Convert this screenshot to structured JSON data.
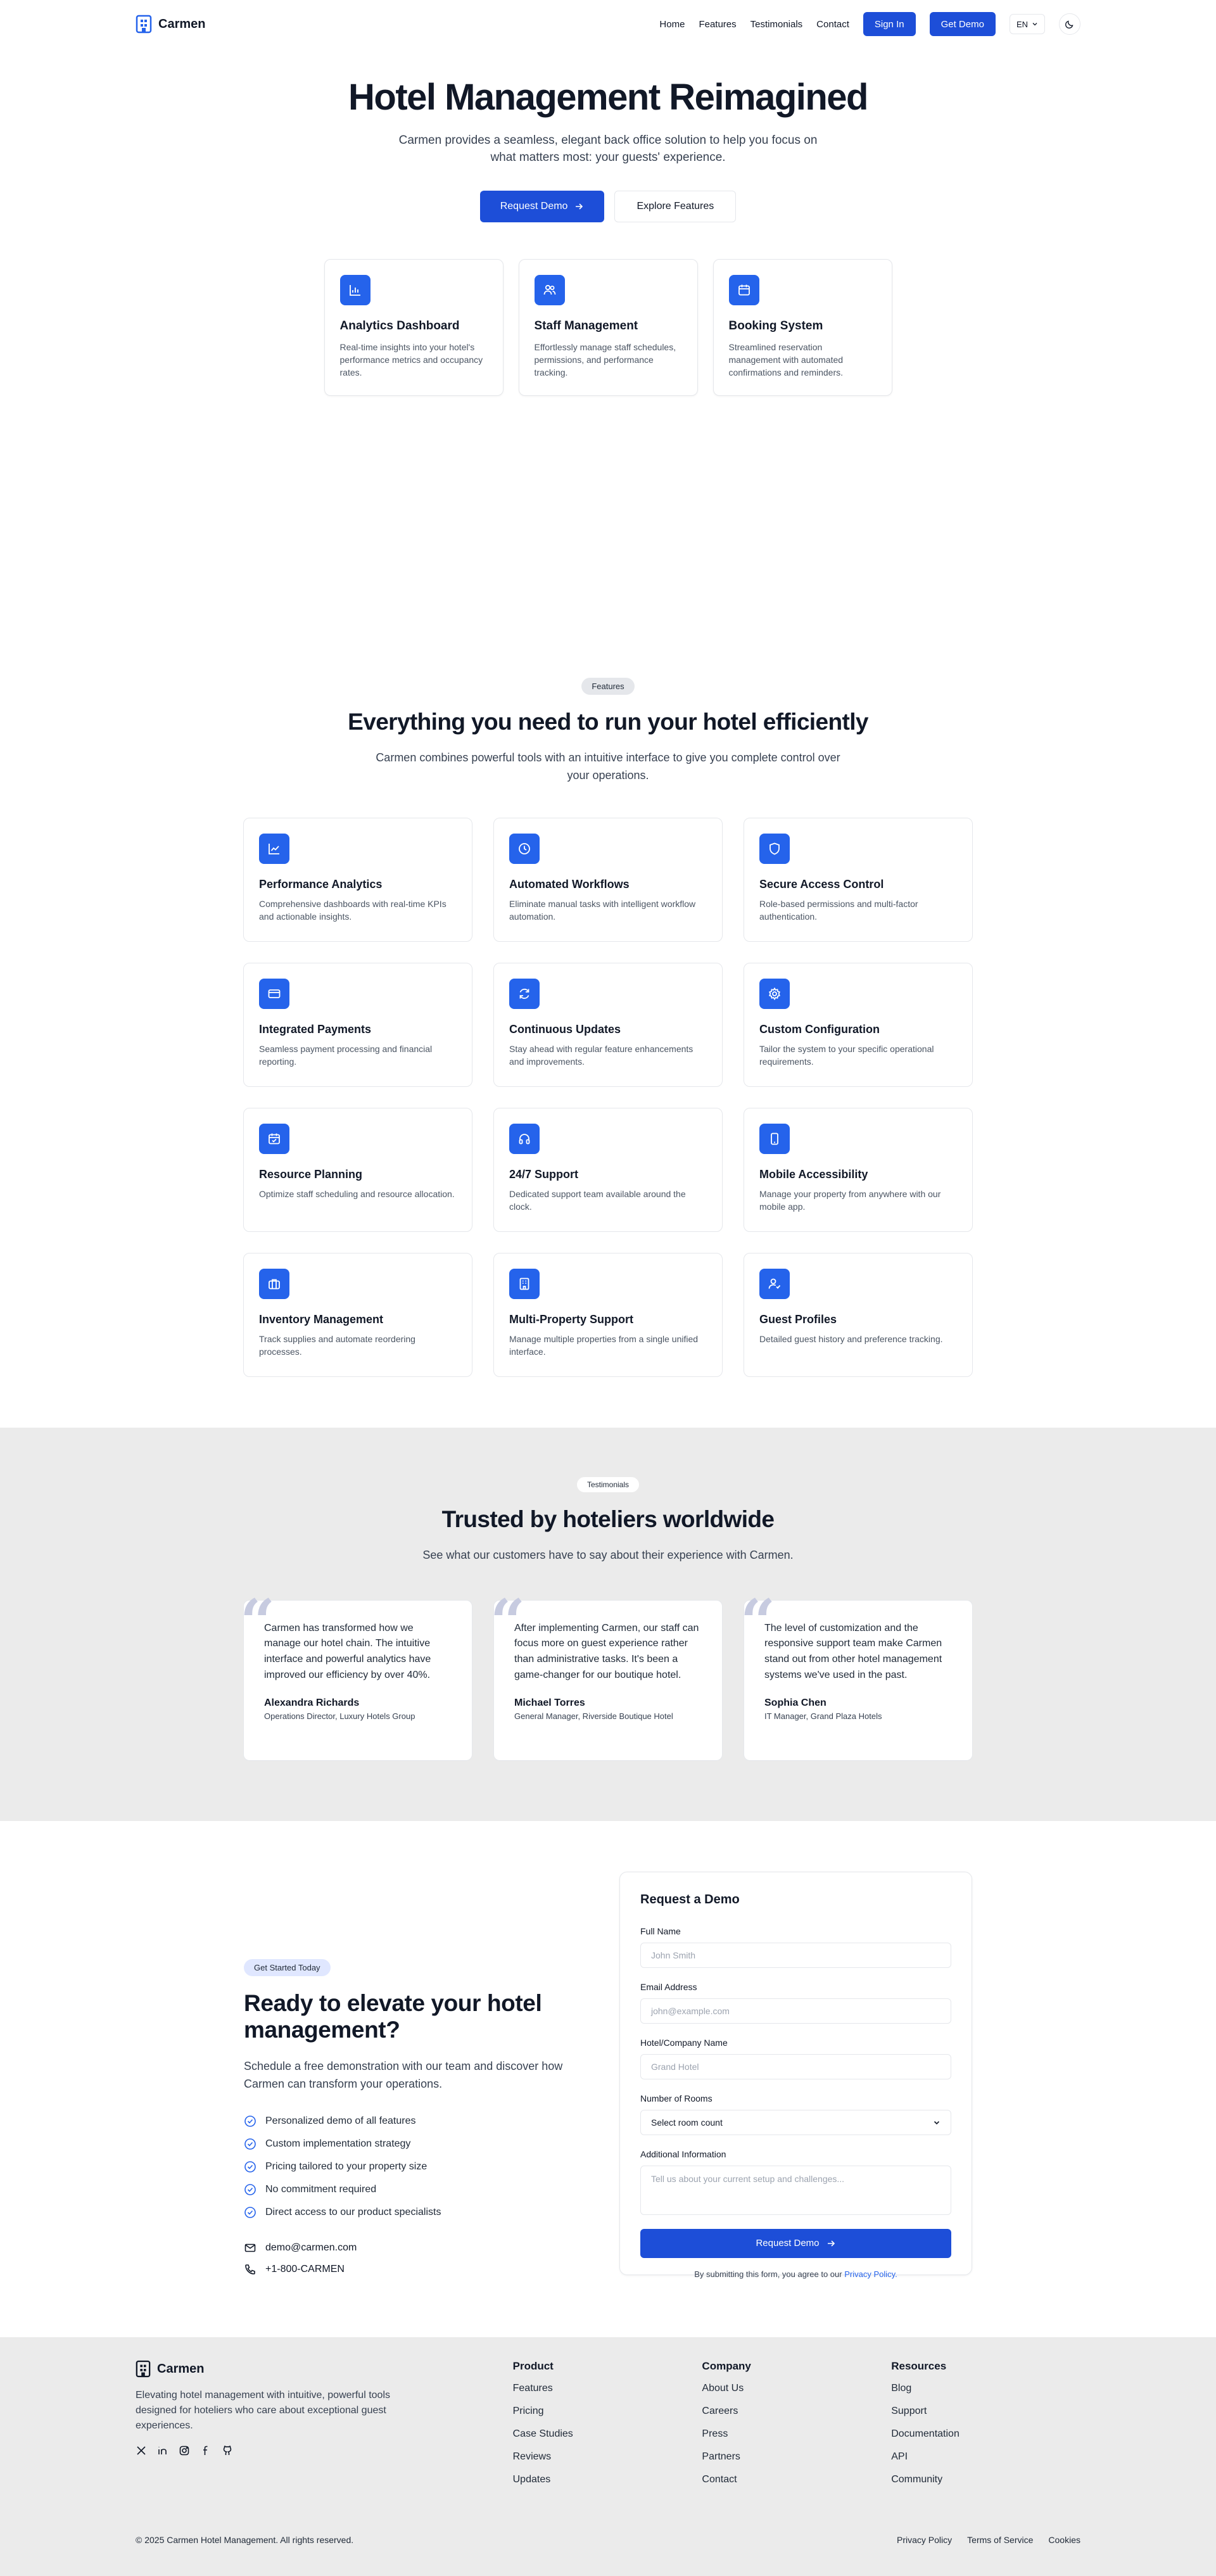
{
  "header": {
    "brand": "Carmen",
    "nav": [
      "Home",
      "Features",
      "Testimonials",
      "Contact"
    ],
    "sign_in": "Sign In",
    "get_demo": "Get Demo",
    "language": "EN"
  },
  "hero": {
    "title": "Hotel Management Reimagined",
    "subtitle": "Carmen provides a seamless, elegant back office solution to help you focus on what matters most: your guests' experience.",
    "primary_cta": "Request Demo",
    "secondary_cta": "Explore Features",
    "cards": [
      {
        "icon": "bar-chart-icon",
        "title": "Analytics Dashboard",
        "desc": "Real-time insights into your hotel's performance metrics and occupancy rates."
      },
      {
        "icon": "users-icon",
        "title": "Staff Management",
        "desc": "Effortlessly manage staff schedules, permissions, and performance tracking."
      },
      {
        "icon": "calendar-icon",
        "title": "Booking System",
        "desc": "Streamlined reservation management with automated confirmations and reminders."
      }
    ]
  },
  "features": {
    "badge": "Features",
    "title": "Everything you need to run your hotel efficiently",
    "subtitle": "Carmen combines powerful tools with an intuitive interface to give you complete control over your operations.",
    "items": [
      {
        "icon": "line-chart-icon",
        "title": "Performance Analytics",
        "desc": "Comprehensive dashboards with real-time KPIs and actionable insights."
      },
      {
        "icon": "clock-icon",
        "title": "Automated Workflows",
        "desc": "Eliminate manual tasks with intelligent workflow automation."
      },
      {
        "icon": "shield-icon",
        "title": "Secure Access Control",
        "desc": "Role-based permissions and multi-factor authentication."
      },
      {
        "icon": "credit-card-icon",
        "title": "Integrated Payments",
        "desc": "Seamless payment processing and financial reporting."
      },
      {
        "icon": "refresh-icon",
        "title": "Continuous Updates",
        "desc": "Stay ahead with regular feature enhancements and improvements."
      },
      {
        "icon": "gear-icon",
        "title": "Custom Configuration",
        "desc": "Tailor the system to your specific operational requirements."
      },
      {
        "icon": "calendar-check-icon",
        "title": "Resource Planning",
        "desc": "Optimize staff scheduling and resource allocation."
      },
      {
        "icon": "headphones-icon",
        "title": "24/7 Support",
        "desc": "Dedicated support team available around the clock."
      },
      {
        "icon": "smartphone-icon",
        "title": "Mobile Accessibility",
        "desc": "Manage your property from anywhere with our mobile app."
      },
      {
        "icon": "briefcase-icon",
        "title": "Inventory Management",
        "desc": "Track supplies and automate reordering processes."
      },
      {
        "icon": "building-icon",
        "title": "Multi-Property Support",
        "desc": "Manage multiple properties from a single unified interface."
      },
      {
        "icon": "user-check-icon",
        "title": "Guest Profiles",
        "desc": "Detailed guest history and preference tracking."
      }
    ]
  },
  "testimonials": {
    "badge": "Testimonials",
    "title": "Trusted by hoteliers worldwide",
    "subtitle": "See what our customers have to say about their experience with Carmen.",
    "items": [
      {
        "quote": "Carmen has transformed how we manage our hotel chain. The intuitive interface and powerful analytics have improved our efficiency by over 40%.",
        "name": "Alexandra Richards",
        "role": "Operations Director, Luxury Hotels Group"
      },
      {
        "quote": "After implementing Carmen, our staff can focus more on guest experience rather than administrative tasks. It's been a game-changer for our boutique hotel.",
        "name": "Michael Torres",
        "role": "General Manager, Riverside Boutique Hotel"
      },
      {
        "quote": "The level of customization and the responsive support team make Carmen stand out from other hotel management systems we've used in the past.",
        "name": "Sophia Chen",
        "role": "IT Manager, Grand Plaza Hotels"
      }
    ]
  },
  "demo": {
    "badge": "Get Started Today",
    "title": "Ready to elevate your hotel management?",
    "subtitle": "Schedule a free demonstration with our team and discover how Carmen can transform your operations.",
    "benefits": [
      "Personalized demo of all features",
      "Custom implementation strategy",
      "Pricing tailored to your property size",
      "No commitment required",
      "Direct access to our product specialists"
    ],
    "email": "demo@carmen.com",
    "phone": "+1-800-CARMEN"
  },
  "form": {
    "title": "Request a Demo",
    "full_name_label": "Full Name",
    "full_name_placeholder": "John Smith",
    "email_label": "Email Address",
    "email_placeholder": "john@example.com",
    "hotel_label": "Hotel/Company Name",
    "hotel_placeholder": "Grand Hotel",
    "rooms_label": "Number of Rooms",
    "rooms_value": "Select room count",
    "info_label": "Additional Information",
    "info_placeholder": "Tell us about your current setup and challenges...",
    "submit": "Request Demo",
    "note_prefix": "By submitting this form, you agree to our",
    "privacy_link": "Privacy Policy."
  },
  "footer": {
    "brand": "Carmen",
    "desc": "Elevating hotel management with intuitive, powerful tools designed for hoteliers who care about exceptional guest experiences.",
    "socials": [
      "x-icon",
      "linkedin-icon",
      "instagram-icon",
      "facebook-icon",
      "github-icon"
    ],
    "columns": [
      {
        "title": "Product",
        "links": [
          "Features",
          "Pricing",
          "Case Studies",
          "Reviews",
          "Updates"
        ]
      },
      {
        "title": "Company",
        "links": [
          "About Us",
          "Careers",
          "Press",
          "Partners",
          "Contact"
        ]
      },
      {
        "title": "Resources",
        "links": [
          "Blog",
          "Support",
          "Documentation",
          "API",
          "Community"
        ]
      }
    ],
    "copyright": "© 2025 Carmen Hotel Management. All rights reserved.",
    "legal": [
      "Privacy Policy",
      "Terms of Service",
      "Cookies"
    ]
  },
  "colors": {
    "accent": "#2563eb",
    "primary_button": "#1d4ed8",
    "section_gray": "#ebebeb"
  }
}
